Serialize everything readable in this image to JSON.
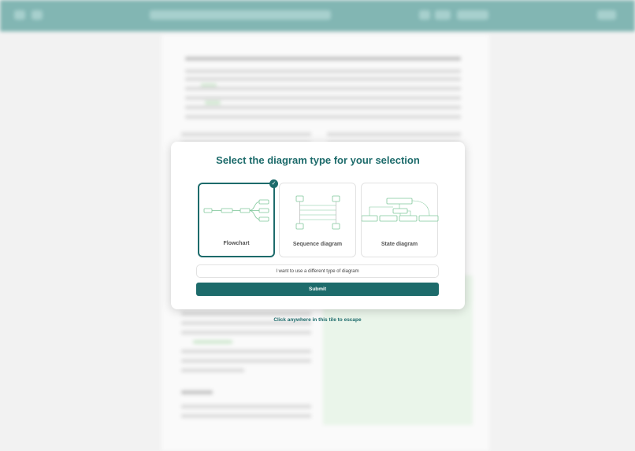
{
  "modal": {
    "title": "Select the diagram type for your selection",
    "options": [
      {
        "label": "Flowchart",
        "selected": true,
        "icon": "flowchart-preview"
      },
      {
        "label": "Sequence diagram",
        "selected": false,
        "icon": "sequence-diagram-preview"
      },
      {
        "label": "State diagram",
        "selected": false,
        "icon": "state-diagram-preview"
      }
    ],
    "other_label": "I want to use a different type of diagram",
    "submit_label": "Submit"
  },
  "escape_hint": "Click anywhere in this tile to escape",
  "colors": {
    "accent": "#1d6b6b",
    "topbar": "#3f8f8b",
    "preview_green": "#7fc79a"
  }
}
